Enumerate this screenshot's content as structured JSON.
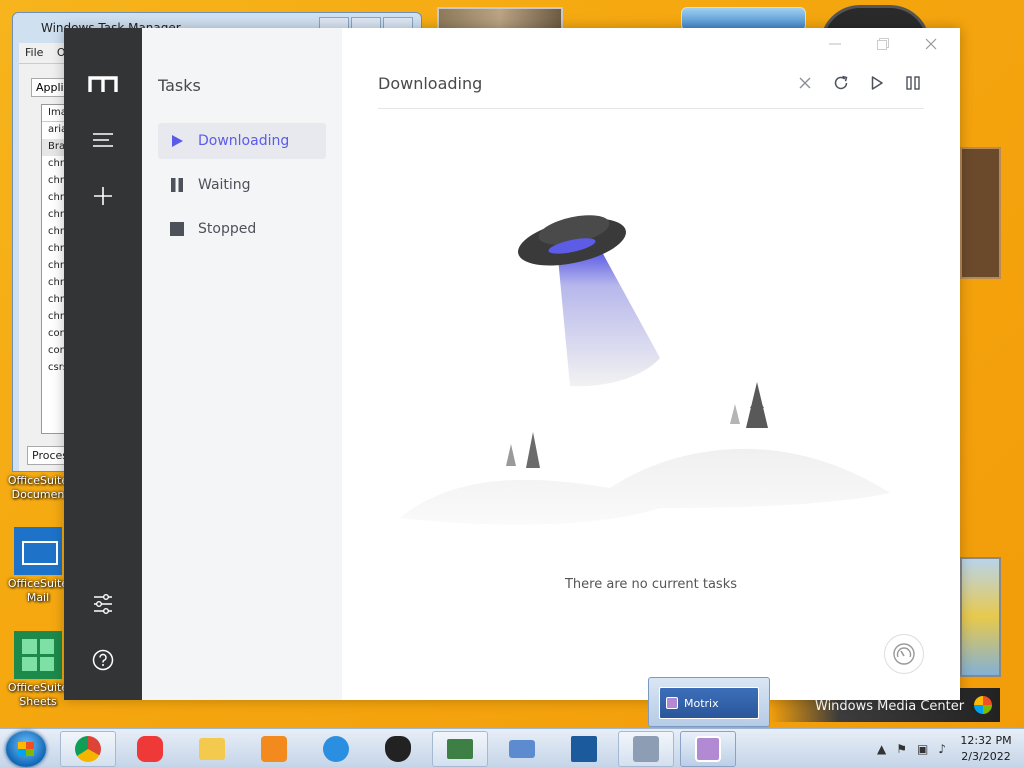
{
  "desktop": {
    "task_manager": {
      "title": "Windows Task Manager",
      "menu": [
        "File",
        "O"
      ],
      "tab": "Applica",
      "list_header": "Ima",
      "rows": [
        "aria",
        "Bra",
        "chr",
        "chr",
        "chr",
        "chr",
        "chr",
        "chr",
        "chr",
        "chr",
        "chr",
        "chr",
        "con",
        "con",
        "csrs"
      ],
      "processes_label": "Processe"
    },
    "icons": [
      {
        "label_line1": "OfficeSuite",
        "label_line2": "Documen"
      },
      {
        "label_line1": "OfficeSuite",
        "label_line2": "Mail"
      },
      {
        "label_line1": "OfficeSuite",
        "label_line2": "Sheets"
      }
    ],
    "media_center_label": "Windows Media Center"
  },
  "motrix": {
    "sidebar_title": "Tasks",
    "nav": [
      {
        "label": "Downloading"
      },
      {
        "label": "Waiting"
      },
      {
        "label": "Stopped"
      }
    ],
    "header_title": "Downloading",
    "empty_message": "There are no current tasks",
    "accent": "#5b5bea"
  },
  "taskbar": {
    "thumbnail_label": "Motrix",
    "clock_time": "12:32 PM",
    "clock_date": "2/3/2022"
  }
}
